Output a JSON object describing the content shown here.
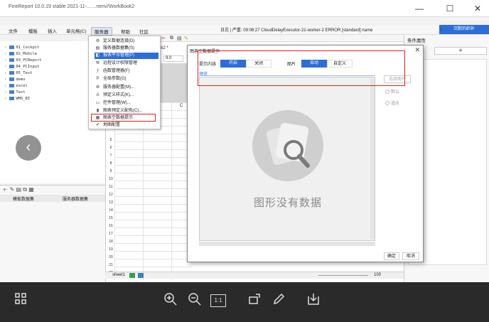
{
  "window": {
    "title": "FineReport 10.0.19 stable 2021-11-...                                 ...nem//WorkBook2",
    "minimize": "—",
    "maximize": "☐",
    "close": "✕"
  },
  "menubar": {
    "items": [
      "文件",
      "模板",
      "插入",
      "单元格(C)"
    ],
    "open_menus": [
      "服务器",
      "帮助",
      "社区"
    ]
  },
  "logbar": {
    "text": "日志 | 严重: 09:08:27 CloudDelayExecutor-21-worker-2 ERROR [standard] name"
  },
  "login_button": "沉默的织补",
  "right_panel": {
    "header": "条件属性",
    "add": "+"
  },
  "file_tree": [
    "01_Cockpit",
    "02_Mobile",
    "03_PCReport",
    "04_PCInput",
    "05_Test",
    "demo",
    "excel",
    "Test",
    "WMS_BI"
  ],
  "left_tabs": [
    "模板数据集",
    "服务器数据集"
  ],
  "dropdown": {
    "items": [
      {
        "label": "定义数据连接(D)",
        "icon": "⚙"
      },
      {
        "label": "服务器数据集(S)",
        "icon": "▤"
      },
      {
        "label": "报表平台管理(P)",
        "icon": "◧"
      },
      {
        "label": "远程设计权限管理",
        "icon": "⚒"
      },
      {
        "label": "函数管理器(F)",
        "icon": "ƒ"
      },
      {
        "label": "全局参数(G)",
        "icon": "P"
      },
      {
        "label": "服务器配置(M)...",
        "icon": "⚙"
      },
      {
        "label": "预定义样式(K)...",
        "icon": "A"
      },
      {
        "label": "控件管理(W)...",
        "icon": "▭"
      },
      {
        "label": "图表预定义配色(C)...",
        "icon": "▮"
      },
      {
        "label": "图表空数据提示",
        "icon": "▦"
      },
      {
        "label": "地图配置",
        "icon": "✔"
      }
    ]
  },
  "editor": {
    "tab": "ok2 *",
    "zoom": "9.0",
    "col_c": "C",
    "rows": [
      "5",
      "6",
      "7",
      "8",
      "9",
      "10",
      "11",
      "12",
      "13",
      "14",
      "15",
      "16",
      "17",
      "18",
      "19",
      "20",
      "21",
      "22",
      "23",
      "24"
    ],
    "sheet": "sheet1",
    "zoom_pct": "100"
  },
  "dialog": {
    "title": "图表空数据提示",
    "close": "✕",
    "prompt_label": "提示内容",
    "prompt_on": "开启",
    "prompt_off": "关闭",
    "image_label": "图片",
    "image_auto": "自动",
    "image_custom": "自定义",
    "preview_label": "预览",
    "nodata_text": "图形没有数据",
    "select_image": "选择图片",
    "radio_default": "默认",
    "radio_fit": "适应",
    "ok": "确定",
    "cancel": "取消"
  },
  "viewer_toolbar": {
    "icons": [
      "grid-icon",
      "zoom-in-icon",
      "zoom-out-icon",
      "actual-size-icon",
      "rotate-icon",
      "edit-icon",
      "download-icon"
    ],
    "actual_size": "1:1"
  },
  "colors": {
    "accent": "#2d6cd9",
    "highlight_box": "#e02020",
    "toolbar_bg": "#2a2a2a"
  }
}
